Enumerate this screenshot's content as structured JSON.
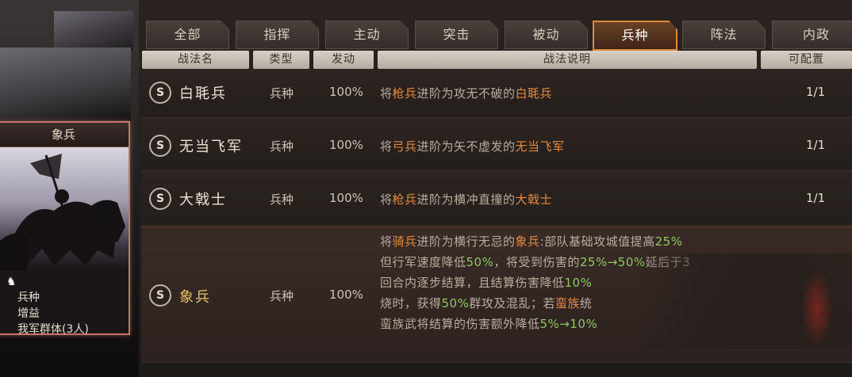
{
  "tabs": [
    {
      "label": "全部"
    },
    {
      "label": "指挥"
    },
    {
      "label": "主动"
    },
    {
      "label": "突击"
    },
    {
      "label": "被动"
    },
    {
      "label": "兵种",
      "active": true
    },
    {
      "label": "阵法"
    },
    {
      "label": "内政"
    }
  ],
  "columns": {
    "name": "战法名",
    "type": "类型",
    "rate": "发动",
    "desc": "战法说明",
    "config": "可配置"
  },
  "rows": [
    {
      "grade": "S",
      "name": "白毦兵",
      "type": "兵种",
      "rate": "100%",
      "desc": [
        [
          "将",
          ""
        ],
        [
          "枪兵",
          "hl"
        ],
        [
          "进阶为攻无不破的",
          ""
        ],
        [
          "白毦兵",
          "hl"
        ]
      ],
      "config": "1/1"
    },
    {
      "grade": "S",
      "name": "无当飞军",
      "type": "兵种",
      "rate": "100%",
      "desc": [
        [
          "将",
          ""
        ],
        [
          "弓兵",
          "hl"
        ],
        [
          "进阶为矢不虚发的",
          ""
        ],
        [
          "无当飞军",
          "hl"
        ]
      ],
      "config": "1/1"
    },
    {
      "grade": "S",
      "name": "大戟士",
      "type": "兵种",
      "rate": "100%",
      "desc": [
        [
          "将",
          ""
        ],
        [
          "枪兵",
          "hl"
        ],
        [
          "进阶为横冲直撞的",
          ""
        ],
        [
          "大戟士",
          "hl"
        ]
      ],
      "config": "1/1"
    },
    {
      "grade": "S",
      "name": "象兵",
      "type": "兵种",
      "rate": "100%",
      "lines": [
        [
          [
            "将",
            ""
          ],
          [
            "骑兵",
            "hl"
          ],
          [
            "进阶为横行无忌的",
            ""
          ],
          [
            "象兵",
            "hl"
          ],
          [
            ":部队基础攻城值提高",
            ""
          ],
          [
            "25%",
            "gr"
          ]
        ],
        [
          [
            "但行军速度降低",
            ""
          ],
          [
            "50%",
            "gr"
          ],
          [
            "，将受到伤害的",
            ""
          ],
          [
            "25%→50%",
            "gr"
          ],
          [
            "延后于3",
            ""
          ]
        ],
        [
          [
            "回合内逐步结算，且结算伤害降低",
            ""
          ],
          [
            "10%",
            "gr"
          ]
        ],
        [
          [
            "烧时，获得",
            ""
          ],
          [
            "50%",
            "gr"
          ],
          [
            "群攻及混乱；若",
            ""
          ],
          [
            "蛮族",
            "hl"
          ],
          [
            "统",
            ""
          ]
        ],
        [
          [
            "蛮族武将结算的伤害额外降低",
            ""
          ],
          [
            "5%→10%",
            "gr"
          ]
        ]
      ],
      "config": ""
    }
  ],
  "card": {
    "title": "象兵",
    "lines": [
      "兵种",
      "增益",
      "我军群体(3人)"
    ]
  }
}
